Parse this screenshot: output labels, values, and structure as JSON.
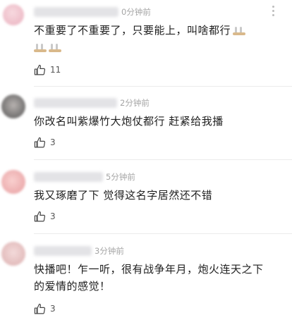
{
  "comments": [
    {
      "time": "0分钟前",
      "text": "不重要了不重要了，只要能上，叫啥都行",
      "likes": "11",
      "avatar_color": "#f2c9d2"
    },
    {
      "time": "2分钟前",
      "text": "你改名叫紫爆竹大炮仗都行 赶紧给我播",
      "likes": "3",
      "avatar_color": "#7a7a7a"
    },
    {
      "time": "5分钟前",
      "text": "我又琢磨了下 觉得这名字居然还不错",
      "likes": "3",
      "avatar_color": "#f1b7b7"
    },
    {
      "time": "3分钟前",
      "text": "快播吧！乍一听，很有战争年月，炮火连天之下的爱情的感觉！",
      "likes": "3",
      "avatar_color": "#eac7c7"
    }
  ]
}
